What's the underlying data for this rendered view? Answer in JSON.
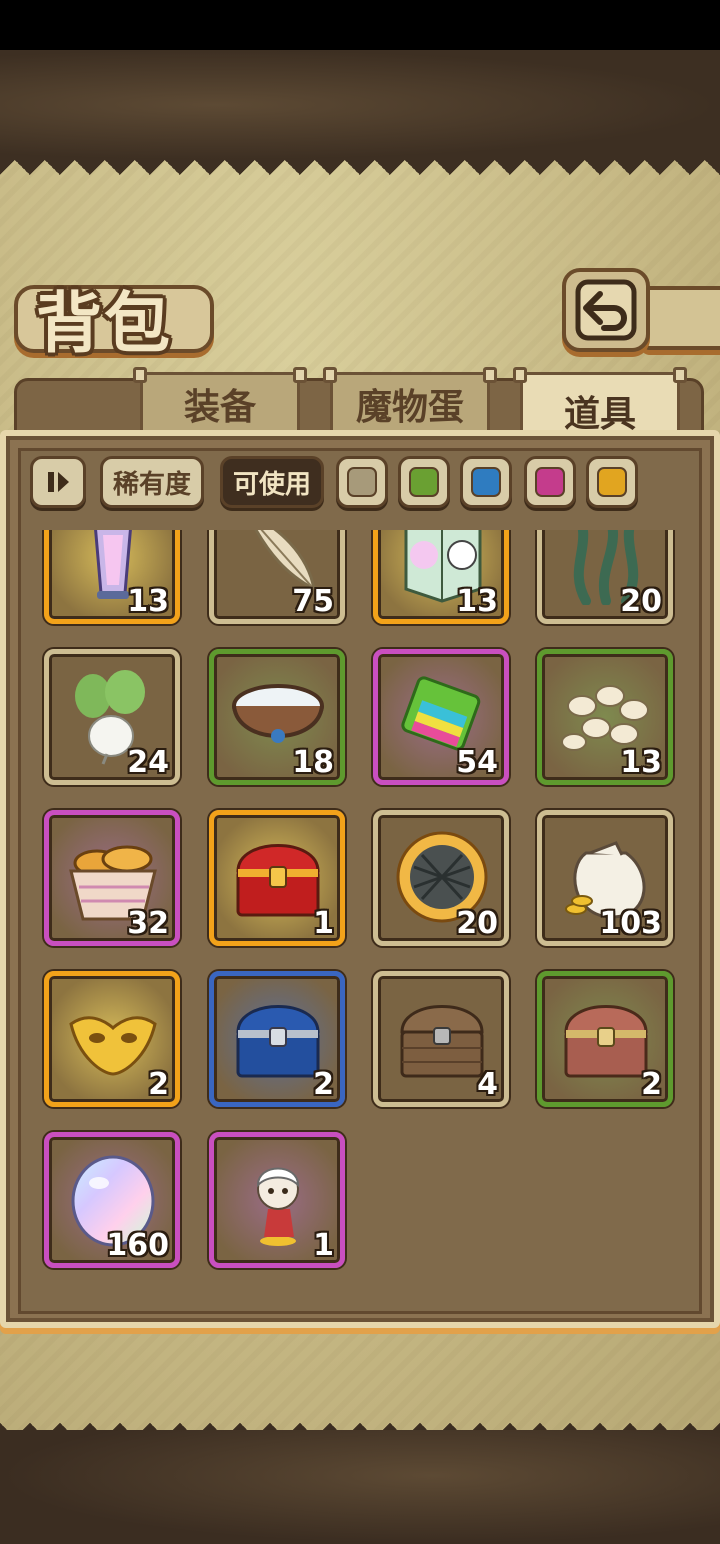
{
  "title": "背包",
  "tabs": [
    {
      "label": "装备",
      "active": false
    },
    {
      "label": "魔物蛋",
      "active": false
    },
    {
      "label": "道具",
      "active": true
    }
  ],
  "filters": {
    "rarity_label": "稀有度",
    "usable_label": "可使用",
    "swatches": [
      "#a79a7a",
      "#6aa032",
      "#2f7cc0",
      "#c43c8c",
      "#e1a520"
    ]
  },
  "items": [
    {
      "icon": "lantern-icon",
      "qty": "13",
      "rarity": "gold"
    },
    {
      "icon": "feather-icon",
      "qty": "75",
      "rarity": "gray"
    },
    {
      "icon": "ghost-box-icon",
      "qty": "13",
      "rarity": "gold"
    },
    {
      "icon": "seaweed-icon",
      "qty": "20",
      "rarity": "gray"
    },
    {
      "icon": "radish-icon",
      "qty": "24",
      "rarity": "gray"
    },
    {
      "icon": "water-bowl-icon",
      "qty": "18",
      "rarity": "green"
    },
    {
      "icon": "rainbow-sponge-icon",
      "qty": "54",
      "rarity": "purple"
    },
    {
      "icon": "beans-icon",
      "qty": "13",
      "rarity": "green"
    },
    {
      "icon": "bread-basket-icon",
      "qty": "32",
      "rarity": "purple"
    },
    {
      "icon": "red-chest-icon",
      "qty": "1",
      "rarity": "gold"
    },
    {
      "icon": "pie-icon",
      "qty": "20",
      "rarity": "gray"
    },
    {
      "icon": "coin-sack-icon",
      "qty": "103",
      "rarity": "gray"
    },
    {
      "icon": "golden-mask-icon",
      "qty": "2",
      "rarity": "gold"
    },
    {
      "icon": "blue-chest-icon",
      "qty": "2",
      "rarity": "blue"
    },
    {
      "icon": "wooden-chest-icon",
      "qty": "4",
      "rarity": "gray"
    },
    {
      "icon": "bronze-chest-icon",
      "qty": "2",
      "rarity": "green"
    },
    {
      "icon": "rainbow-egg-icon",
      "qty": "160",
      "rarity": "purple"
    },
    {
      "icon": "character-figure-icon",
      "qty": "1",
      "rarity": "purple"
    }
  ]
}
